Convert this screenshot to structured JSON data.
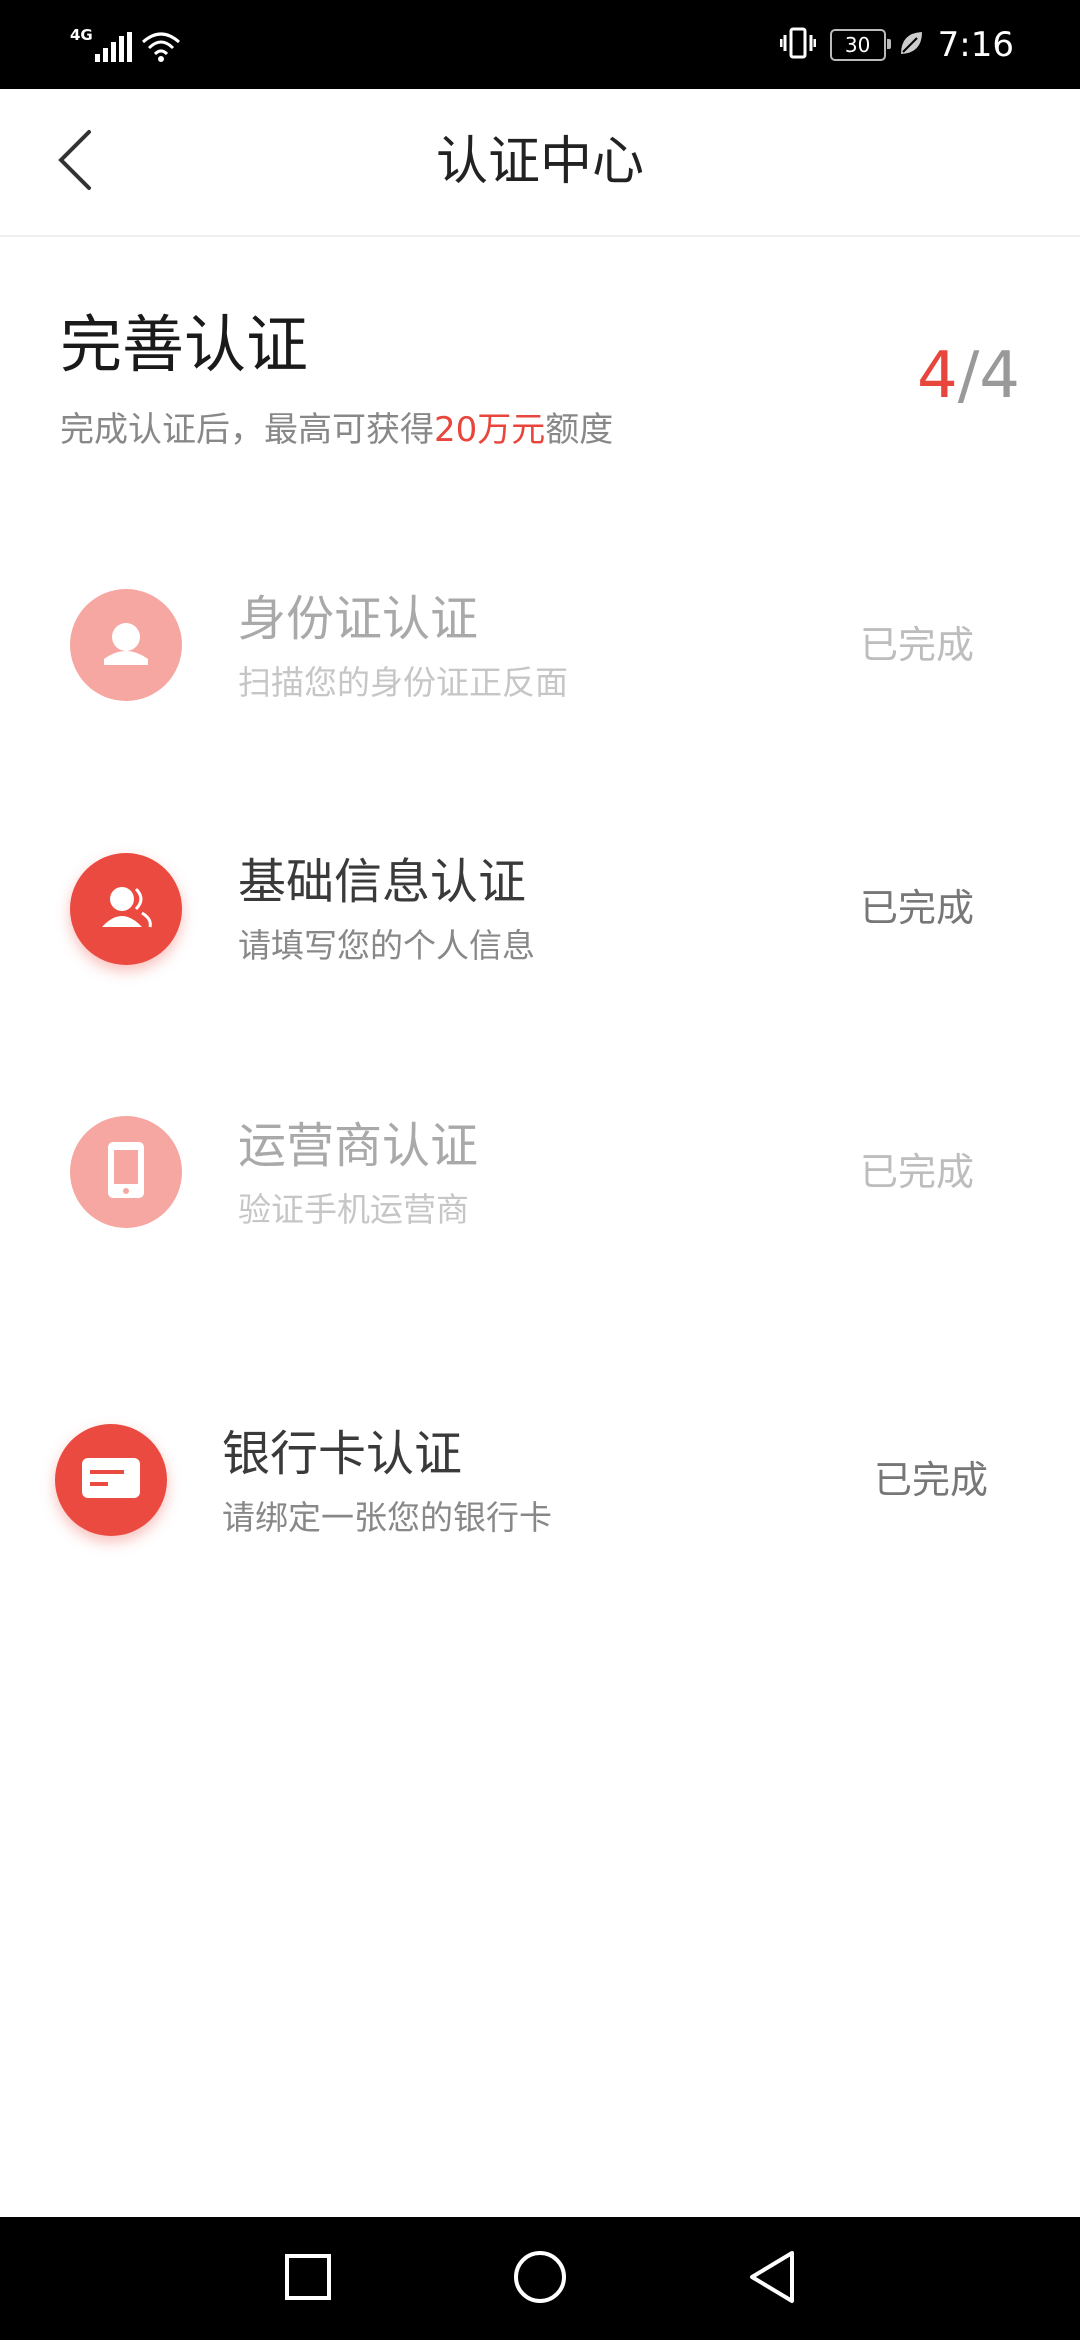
{
  "status_bar": {
    "network": "4G",
    "battery": "30",
    "time": "7:16",
    "icons": [
      "signal-icon",
      "wifi-icon",
      "vibrate-icon",
      "battery-icon",
      "leaf-icon"
    ]
  },
  "header": {
    "title": "认证中心",
    "back_icon": "chevron-left-icon"
  },
  "summary": {
    "title": "完善认证",
    "subtitle_prefix": "完成认证后，最高可获得",
    "subtitle_highlight": "20万元",
    "subtitle_suffix": "额度",
    "progress_done": "4",
    "progress_total": "/4"
  },
  "items": [
    {
      "name": "身份证认证",
      "desc": "扫描您的身份证正反面",
      "status": "已完成",
      "icon": "person-icon"
    },
    {
      "name": "基础信息认证",
      "desc": "请填写您的个人信息",
      "status": "已完成",
      "icon": "users-icon"
    },
    {
      "name": "运营商认证",
      "desc": "验证手机运营商",
      "status": "已完成",
      "icon": "phone-icon"
    },
    {
      "name": "银行卡认证",
      "desc": "请绑定一张您的银行卡",
      "status": "已完成",
      "icon": "card-icon"
    }
  ],
  "nav_bar": {
    "icons": [
      "recent-apps-icon",
      "home-icon",
      "back-icon"
    ]
  },
  "colors": {
    "accent": "#e8453c",
    "icon_active": "#ea4a3f",
    "icon_faded": "#f7a7a1"
  }
}
